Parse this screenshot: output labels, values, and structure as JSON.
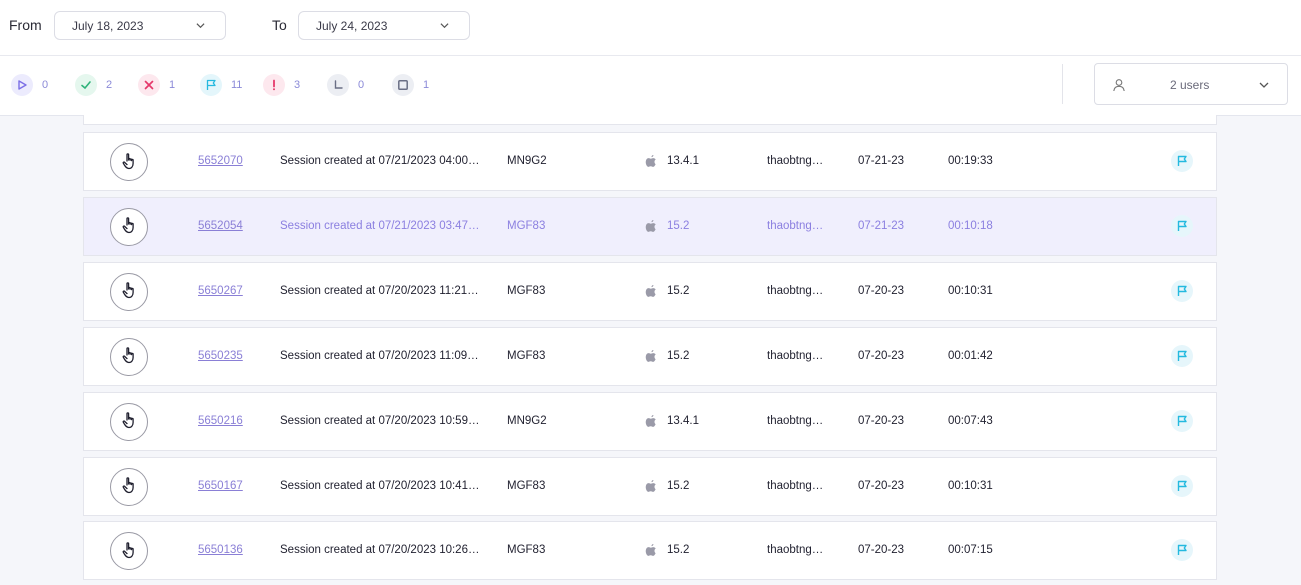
{
  "date_filter": {
    "from_label": "From",
    "from_value": "July 18, 2023",
    "to_label": "To",
    "to_value": "July 24, 2023"
  },
  "status_counts": [
    {
      "name": "running",
      "icon": "play-icon",
      "count": "0",
      "color": "#7b6ee6",
      "bg": "#ecebfd"
    },
    {
      "name": "passed",
      "icon": "check-icon",
      "count": "2",
      "color": "#2fb37a",
      "bg": "#e5f7ee"
    },
    {
      "name": "failed",
      "icon": "x-icon",
      "count": "1",
      "color": "#e5386b",
      "bg": "#fde8ee"
    },
    {
      "name": "flagged",
      "icon": "flag-icon",
      "count": "11",
      "color": "#24b9df",
      "bg": "#e4f6fb"
    },
    {
      "name": "error",
      "icon": "exclamation-icon",
      "count": "3",
      "color": "#e5386b",
      "bg": "#fde8ee"
    },
    {
      "name": "pending",
      "icon": "clock-icon",
      "count": "0",
      "color": "#6a6f85",
      "bg": "#eceef3"
    },
    {
      "name": "stopped",
      "icon": "square-icon",
      "count": "1",
      "color": "#6a6f85",
      "bg": "#eceef3"
    }
  ],
  "users_filter": {
    "value": "2 users"
  },
  "sessions": [
    {
      "id": "5652070",
      "description": "Session created at 07/21/2023 04:00 …",
      "device": "MN9G2",
      "os": "13.4.1",
      "user": "thaobtng…",
      "date": "07-21-23",
      "duration": "00:19:33",
      "selected": false
    },
    {
      "id": "5652054",
      "description": "Session created at 07/21/2023 03:47 …",
      "device": "MGF83",
      "os": "15.2",
      "user": "thaobtng…",
      "date": "07-21-23",
      "duration": "00:10:18",
      "selected": true
    },
    {
      "id": "5650267",
      "description": "Session created at 07/20/2023 11:21 A…",
      "device": "MGF83",
      "os": "15.2",
      "user": "thaobtng…",
      "date": "07-20-23",
      "duration": "00:10:31",
      "selected": false
    },
    {
      "id": "5650235",
      "description": "Session created at 07/20/2023 11:09 …",
      "device": "MGF83",
      "os": "15.2",
      "user": "thaobtng…",
      "date": "07-20-23",
      "duration": "00:01:42",
      "selected": false
    },
    {
      "id": "5650216",
      "description": "Session created at 07/20/2023 10:59 …",
      "device": "MN9G2",
      "os": "13.4.1",
      "user": "thaobtng…",
      "date": "07-20-23",
      "duration": "00:07:43",
      "selected": false
    },
    {
      "id": "5650167",
      "description": "Session created at 07/20/2023 10:41 …",
      "device": "MGF83",
      "os": "15.2",
      "user": "thaobtng…",
      "date": "07-20-23",
      "duration": "00:10:31",
      "selected": false
    },
    {
      "id": "5650136",
      "description": "Session created at 07/20/2023 10:26 …",
      "device": "MGF83",
      "os": "15.2",
      "user": "thaobtng…",
      "date": "07-20-23",
      "duration": "00:07:15",
      "selected": false
    }
  ]
}
